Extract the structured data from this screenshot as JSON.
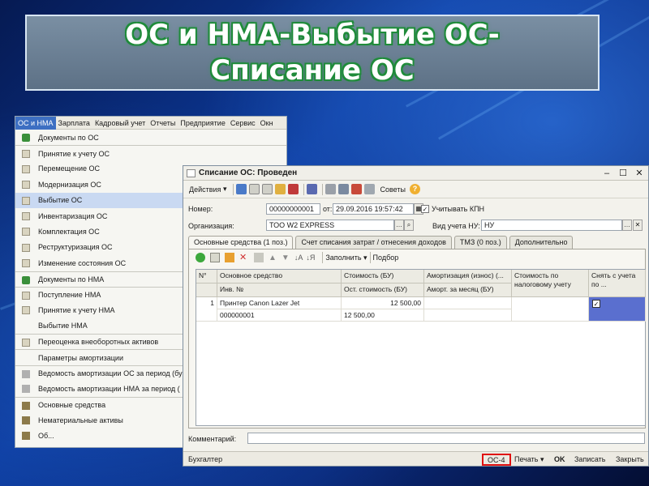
{
  "slide": {
    "title": "ОС и НМА-Выбытие ОС-Списание ОС"
  },
  "menu_bar": {
    "items": [
      "ОС и НМА",
      "Зарплата",
      "Кадровый учет",
      "Отчеты",
      "Предприятие",
      "Сервис",
      "Окн"
    ]
  },
  "menu": {
    "items": [
      {
        "label": "Документы по ОС",
        "icon": "document-icon"
      },
      {
        "label": "Принятие к учету ОС",
        "icon": "document-icon"
      },
      {
        "label": "Перемещение ОС",
        "icon": "document-icon"
      },
      {
        "label": "Модернизация ОС",
        "icon": "document-icon"
      },
      {
        "label": "Выбытие ОС",
        "icon": "document-icon"
      },
      {
        "label": "Инвентаризация ОС",
        "icon": "document-icon"
      },
      {
        "label": "Комплектация ОС",
        "icon": "document-icon"
      },
      {
        "label": "Реструктуризация ОС",
        "icon": "document-icon"
      },
      {
        "label": "Изменение состояния ОС",
        "icon": "document-icon"
      },
      {
        "label": "Документы по НМА",
        "icon": "document-icon"
      },
      {
        "label": "Поступление НМА",
        "icon": "document-icon"
      },
      {
        "label": "Принятие к учету НМА",
        "icon": "document-icon"
      },
      {
        "label": "Выбытие НМА",
        "icon": "document-icon"
      },
      {
        "label": "Переоценка внеоборотных активов",
        "icon": "document-icon"
      },
      {
        "label": "Параметры амортизации",
        "icon": "document-icon"
      },
      {
        "label": "Ведомость амортизации ОС за период (бу",
        "icon": "report-icon"
      },
      {
        "label": "Ведомость амортизации НМА за период (",
        "icon": "report-icon"
      },
      {
        "label": "Основные средства",
        "icon": "catalog-icon"
      },
      {
        "label": "Нематериальные активы",
        "icon": "catalog-icon"
      },
      {
        "label": "Об...",
        "icon": "catalog-icon"
      }
    ]
  },
  "doc": {
    "title": "Списание ОС: Проведен",
    "toolbar": {
      "actions_label": "Действия",
      "advices_label": "Советы"
    },
    "form": {
      "number_label": "Номер:",
      "number_value": "00000000001",
      "date_label": "от:",
      "date_value": "29.09.2016 19:57:42",
      "kpn_label": "Учитывать КПН",
      "org_label": "Организация:",
      "org_value": "ТОО W2 EXPRESS",
      "nu_label": "Вид учета НУ:",
      "nu_value": "НУ"
    },
    "tabs": [
      "Основные средства (1 поз.)",
      "Счет списания затрат / отнесения доходов",
      "ТМЗ (0 поз.)",
      "Дополнительно"
    ],
    "table_toolbar": {
      "fill_label": "Заполнить",
      "select_label": "Подбор"
    },
    "table": {
      "headers_top": [
        "N°",
        "Основное средство",
        "Стоимость (БУ)",
        "Амортизация (износ) (...",
        "Стоимость по налоговому учету",
        "Снять с учета по ..."
      ],
      "headers_bottom": [
        "",
        "Инв. №",
        "Ост. стоимость (БУ)",
        "Аморт. за месяц (БУ)",
        "",
        ""
      ],
      "rows": [
        {
          "n": "1",
          "asset": "Принтер Canon Lazer Jet",
          "inv": "000000001",
          "cost": "12 500,00",
          "residual": "12 500,00",
          "checked": true
        }
      ]
    },
    "comment_label": "Комментарий:",
    "status": {
      "user": "Бухгалтер",
      "os4": "ОС-4",
      "print": "Печать",
      "ok": "OK",
      "save": "Записать",
      "close": "Закрыть"
    }
  },
  "colors": {
    "title_outline": "#1f8b3a",
    "menu_highlight": "#c9d9f2",
    "selected_cell": "#5a6fcf",
    "os4_border": "#e01010"
  }
}
